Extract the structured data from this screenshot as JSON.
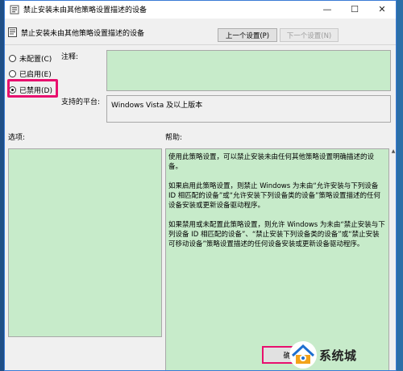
{
  "window": {
    "title": "禁止安装未由其他策略设置描述的设备",
    "minimize_glyph": "—",
    "maximize_glyph": "☐",
    "close_glyph": "✕"
  },
  "header": {
    "policy_title": "禁止安装未由其他策略设置描述的设备",
    "prev_label": "上一个设置(P)",
    "next_label": "下一个设置(N)"
  },
  "state_options": [
    {
      "label": "未配置(C)",
      "selected": false
    },
    {
      "label": "已启用(E)",
      "selected": false
    },
    {
      "label": "已禁用(D)",
      "selected": true
    }
  ],
  "labels": {
    "comment": "注释:",
    "platform": "支持的平台:",
    "options": "选项:",
    "help": "帮助:"
  },
  "comment_value": "",
  "platform_value": "Windows Vista 及以上版本",
  "help_paragraphs": [
    "使用此策略设置，可以禁止安装未由任何其他策略设置明确描述的设备。",
    "如果启用此策略设置，则禁止 Windows 为未由“允许安装与下列设备 ID 相匹配的设备”或“允许安装下列设备类的设备”策略设置描述的任何设备安装或更新设备驱动程序。",
    "如果禁用或未配置此策略设置，则允许 Windows 为未由“禁止安装与下列设备 ID 相匹配的设备”、“禁止安装下列设备类的设备”或“禁止安装可移动设备”策略设置描述的任何设备安装或更新设备驱动程序。"
  ],
  "bottom_button_label": "确",
  "watermark_text": "系统城",
  "colors": {
    "accent_highlight": "#e8106e",
    "field_green": "#c7ebca",
    "window_bg": "#f0f0f0"
  }
}
